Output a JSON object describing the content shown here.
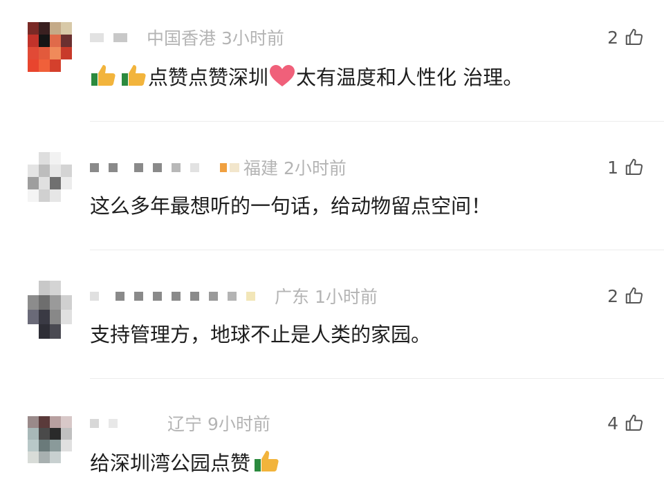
{
  "comments": [
    {
      "location": "中国香港",
      "time": "3小时前",
      "likes": "2",
      "text": "点赞点赞深圳",
      "text2": "太有温度和人性化 治理。",
      "emoji_before": [
        "thumbs-up-icon",
        "thumbs-up-icon"
      ],
      "emoji_middle": "heart-icon"
    },
    {
      "location": "福建",
      "time": "2小时前",
      "likes": "1",
      "text": "这么多年最想听的一句话，给动物留点空间！"
    },
    {
      "location": "广东",
      "time": "1小时前",
      "likes": "2",
      "text": "支持管理方，地球不止是人类的家园。"
    },
    {
      "location": "辽宁",
      "time": "9小时前",
      "likes": "4",
      "text": "给深圳湾公园点赞",
      "emoji_after": "thumbs-up-icon"
    }
  ],
  "colors": {
    "meta_text": "#b4b4b4",
    "body_text": "#1e1e1e",
    "divider": "#ececec",
    "heart": "#f0607a",
    "thumb": "#f2b43c"
  }
}
